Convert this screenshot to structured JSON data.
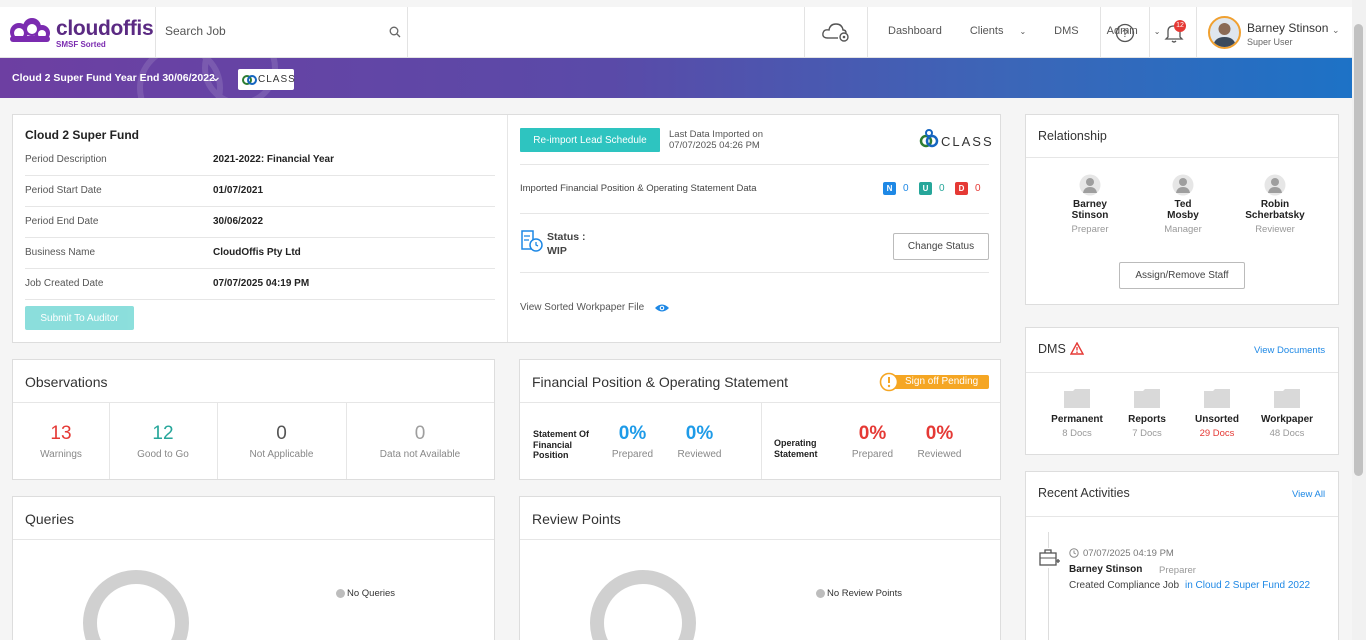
{
  "header": {
    "logo_name": "cloudoffis",
    "logo_tagline": "SMSF Sorted",
    "search_placeholder": "Search Job",
    "nav": [
      {
        "label": "Dashboard"
      },
      {
        "label": "Clients",
        "dropdown": true
      },
      {
        "label": "DMS"
      },
      {
        "label": "Admin",
        "dropdown": true
      }
    ],
    "notification_count": "12",
    "user_name": "Barney Stinson",
    "user_role": "Super User"
  },
  "banner": {
    "title": "Cloud 2 Super Fund Year End 30/06/2022",
    "class_logo_text": "CLASS"
  },
  "fund": {
    "name": "Cloud 2 Super Fund",
    "rows": [
      {
        "label": "Period Description",
        "value": "2021-2022: Financial Year"
      },
      {
        "label": "Period Start Date",
        "value": "01/07/2021"
      },
      {
        "label": "Period End Date",
        "value": "30/06/2022"
      },
      {
        "label": "Business Name",
        "value": "CloudOffis Pty Ltd"
      },
      {
        "label": "Job Created Date",
        "value": "07/07/2025 04:19 PM"
      }
    ],
    "submit_button": "Submit To Auditor"
  },
  "import": {
    "reimport_button": "Re-import Lead Schedule",
    "last_imported_label": "Last Data Imported on",
    "last_imported_value": "07/07/2025 04:26 PM",
    "class_logo_text": "CLASS",
    "imported_label": "Imported Financial Position & Operating Statement Data",
    "counts": {
      "N": "0",
      "U": "0",
      "D": "0"
    },
    "status_label": "Status :",
    "status_value": "WIP",
    "change_status_button": "Change Status",
    "view_workpaper": "View Sorted Workpaper File"
  },
  "observations": {
    "title": "Observations",
    "stats": [
      {
        "value": "13",
        "label": "Warnings",
        "color": "#e53935"
      },
      {
        "value": "12",
        "label": "Good to Go",
        "color": "#26a69a"
      },
      {
        "value": "0",
        "label": "Not Applicable",
        "color": "#555555"
      },
      {
        "value": "0",
        "label": "Data not Available",
        "color": "#9e9e9e"
      }
    ]
  },
  "financial": {
    "title": "Financial Position & Operating Statement",
    "signoff_badge": "Sign off Pending",
    "statement1_label": "Statement Of Financial Position",
    "statement1_prepared": "0%",
    "statement1_reviewed": "0%",
    "statement2_label": "Operating Statement",
    "statement2_prepared": "0%",
    "statement2_reviewed": "0%",
    "prepared_label": "Prepared",
    "reviewed_label": "Reviewed"
  },
  "queries": {
    "title": "Queries",
    "legend": "No Queries"
  },
  "review_points": {
    "title": "Review Points",
    "legend": "No Review Points"
  },
  "relationship": {
    "title": "Relationship",
    "people": [
      {
        "first": "Barney",
        "last": "Stinson",
        "role": "Preparer"
      },
      {
        "first": "Ted",
        "last": "Mosby",
        "role": "Manager"
      },
      {
        "first": "Robin",
        "last": "Scherbatsky",
        "role": "Reviewer"
      }
    ],
    "assign_button": "Assign/Remove Staff"
  },
  "dms": {
    "title": "DMS",
    "view_documents": "View Documents",
    "folders": [
      {
        "name": "Permanent",
        "docs": "8 Docs",
        "alert": false
      },
      {
        "name": "Reports",
        "docs": "7 Docs",
        "alert": false
      },
      {
        "name": "Unsorted",
        "docs": "29 Docs",
        "alert": true
      },
      {
        "name": "Workpaper",
        "docs": "48 Docs",
        "alert": false
      }
    ]
  },
  "activities": {
    "title": "Recent Activities",
    "view_all": "View All",
    "items": [
      {
        "time": "07/07/2025 04:19 PM",
        "user": "Barney Stinson",
        "role": "Preparer",
        "action": "Created Compliance Job",
        "context": "in Cloud 2 Super Fund 2022"
      }
    ]
  }
}
